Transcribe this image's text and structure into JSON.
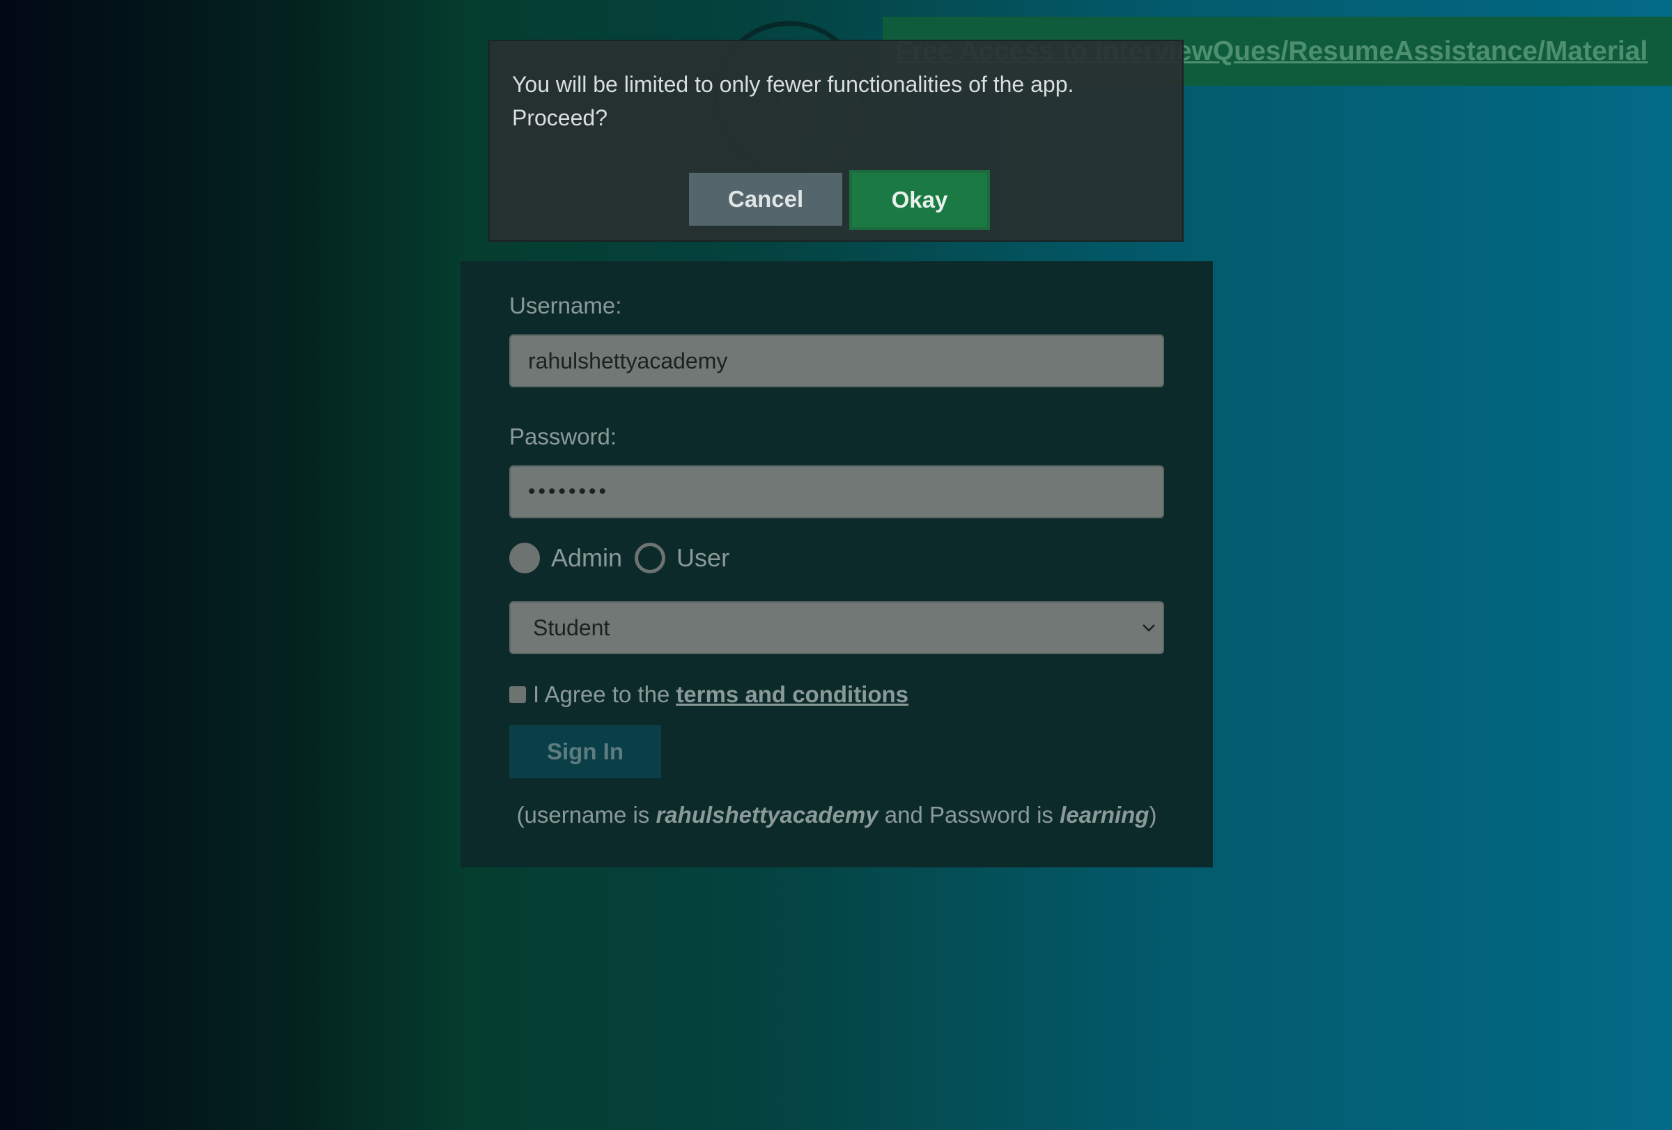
{
  "banner": {
    "link_text": "Free Access to InterviewQues/ResumeAssistance/Material"
  },
  "dialog": {
    "message": "You will be limited to only fewer functionalities of the app. Proceed?",
    "cancel_label": "Cancel",
    "okay_label": "Okay"
  },
  "login": {
    "username_label": "Username:",
    "username_value": "rahulshettyacademy",
    "password_label": "Password:",
    "password_value": "••••••••",
    "role_options": [
      {
        "label": "Admin",
        "selected": true
      },
      {
        "label": "User",
        "selected": false
      }
    ],
    "select_value": "Student",
    "agree_prefix": "I Agree to the",
    "terms_link": "terms and conditions",
    "agree_checked": false,
    "signin_label": "Sign In",
    "hint": {
      "open": "(username is",
      "username": "rahulshettyacademy",
      "middle": "and Password is",
      "password": "learning",
      "close": ")"
    }
  },
  "colors": {
    "okay_button": "#1b7a43",
    "cancel_button": "#54656b",
    "banner": "#0f5c3c",
    "card": "#0d2a2a"
  },
  "icons": [
    "lock-icon",
    "chevron-down-icon"
  ]
}
